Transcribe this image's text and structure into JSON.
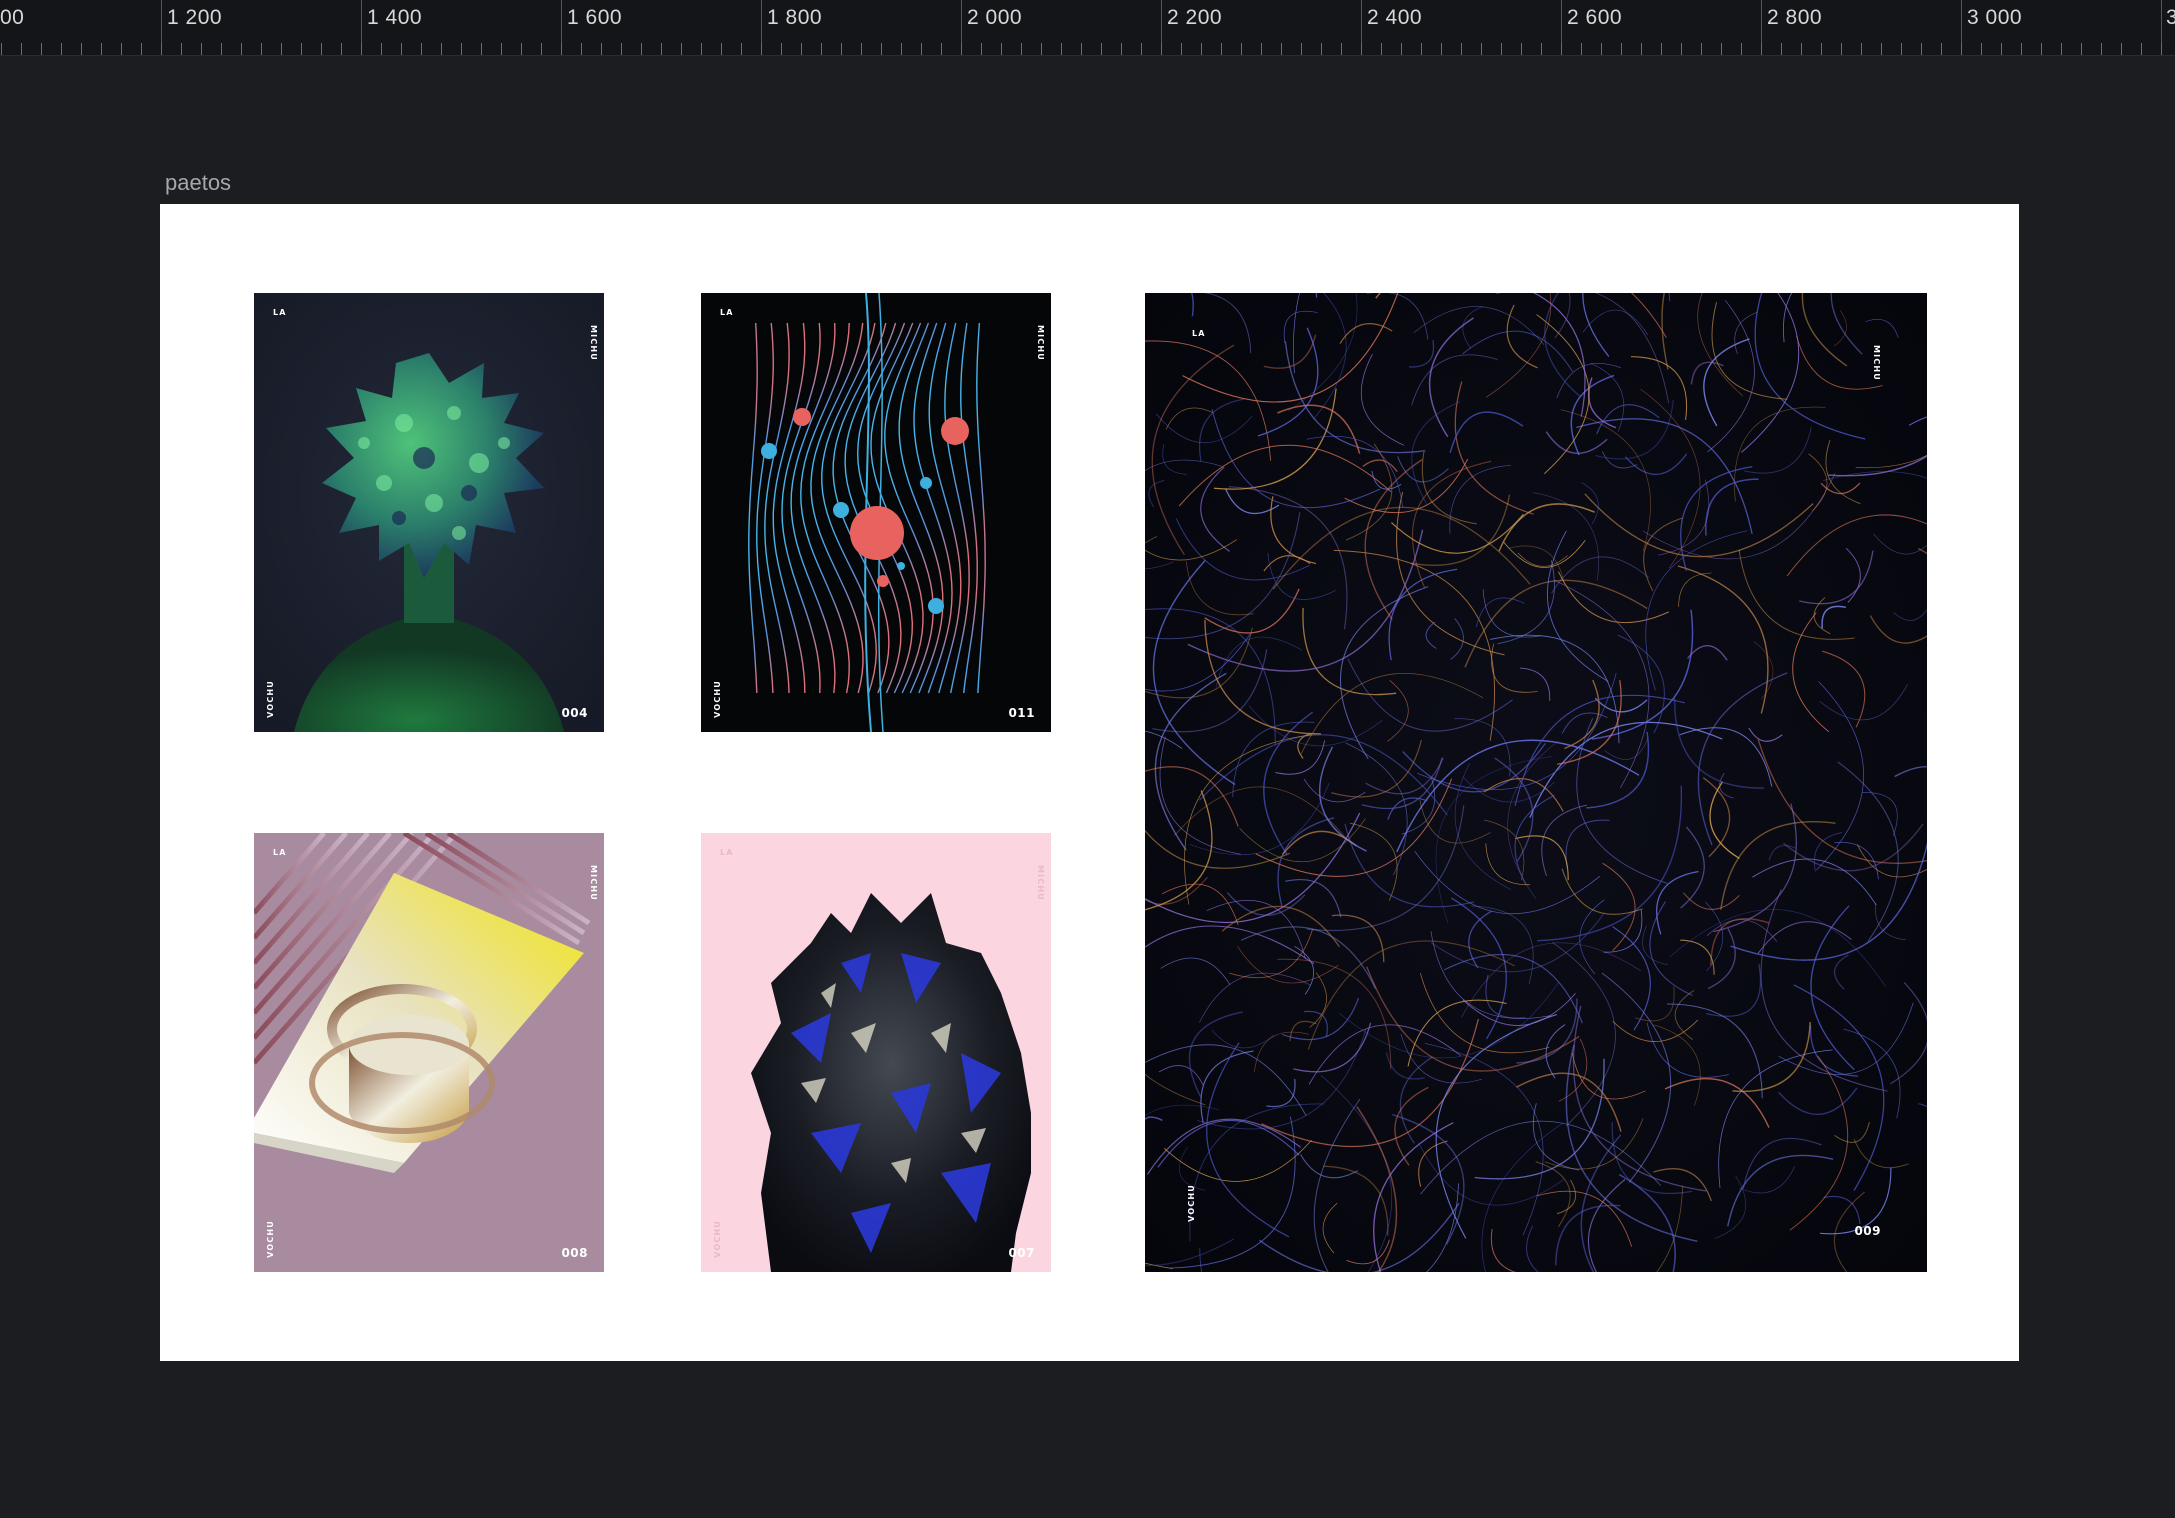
{
  "ruler": {
    "labels": [
      "00",
      "1 200",
      "1 400",
      "1 600",
      "1 800",
      "2 000",
      "2 200",
      "2 400",
      "2 600",
      "2 800",
      "3 000",
      "3"
    ]
  },
  "frame": {
    "name": "paetos"
  },
  "posters": [
    {
      "top_left": "LA",
      "right_side": "MICHU",
      "left_side": "VOCHU",
      "number": "004",
      "theme": "green-flower-head"
    },
    {
      "top_left": "LA",
      "right_side": "MICHU",
      "left_side": "VOCHU",
      "number": "011",
      "theme": "wave-lines-spheres"
    },
    {
      "top_left": "LA",
      "right_side": "MICHU",
      "left_side": "VOCHU",
      "number": "008",
      "theme": "gold-ring-prism"
    },
    {
      "top_left": "LA",
      "right_side": "MICHU",
      "left_side": "VOCHU",
      "number": "007",
      "theme": "blue-chrome-rock"
    },
    {
      "top_left": "LA",
      "right_side": "MICHU",
      "left_side": "VOCHU",
      "number": "009",
      "theme": "particle-mesh"
    }
  ],
  "colors": {
    "canvas_bg": "#1c1d20",
    "ruler_bg": "#141518",
    "artboard_bg": "#ffffff"
  }
}
